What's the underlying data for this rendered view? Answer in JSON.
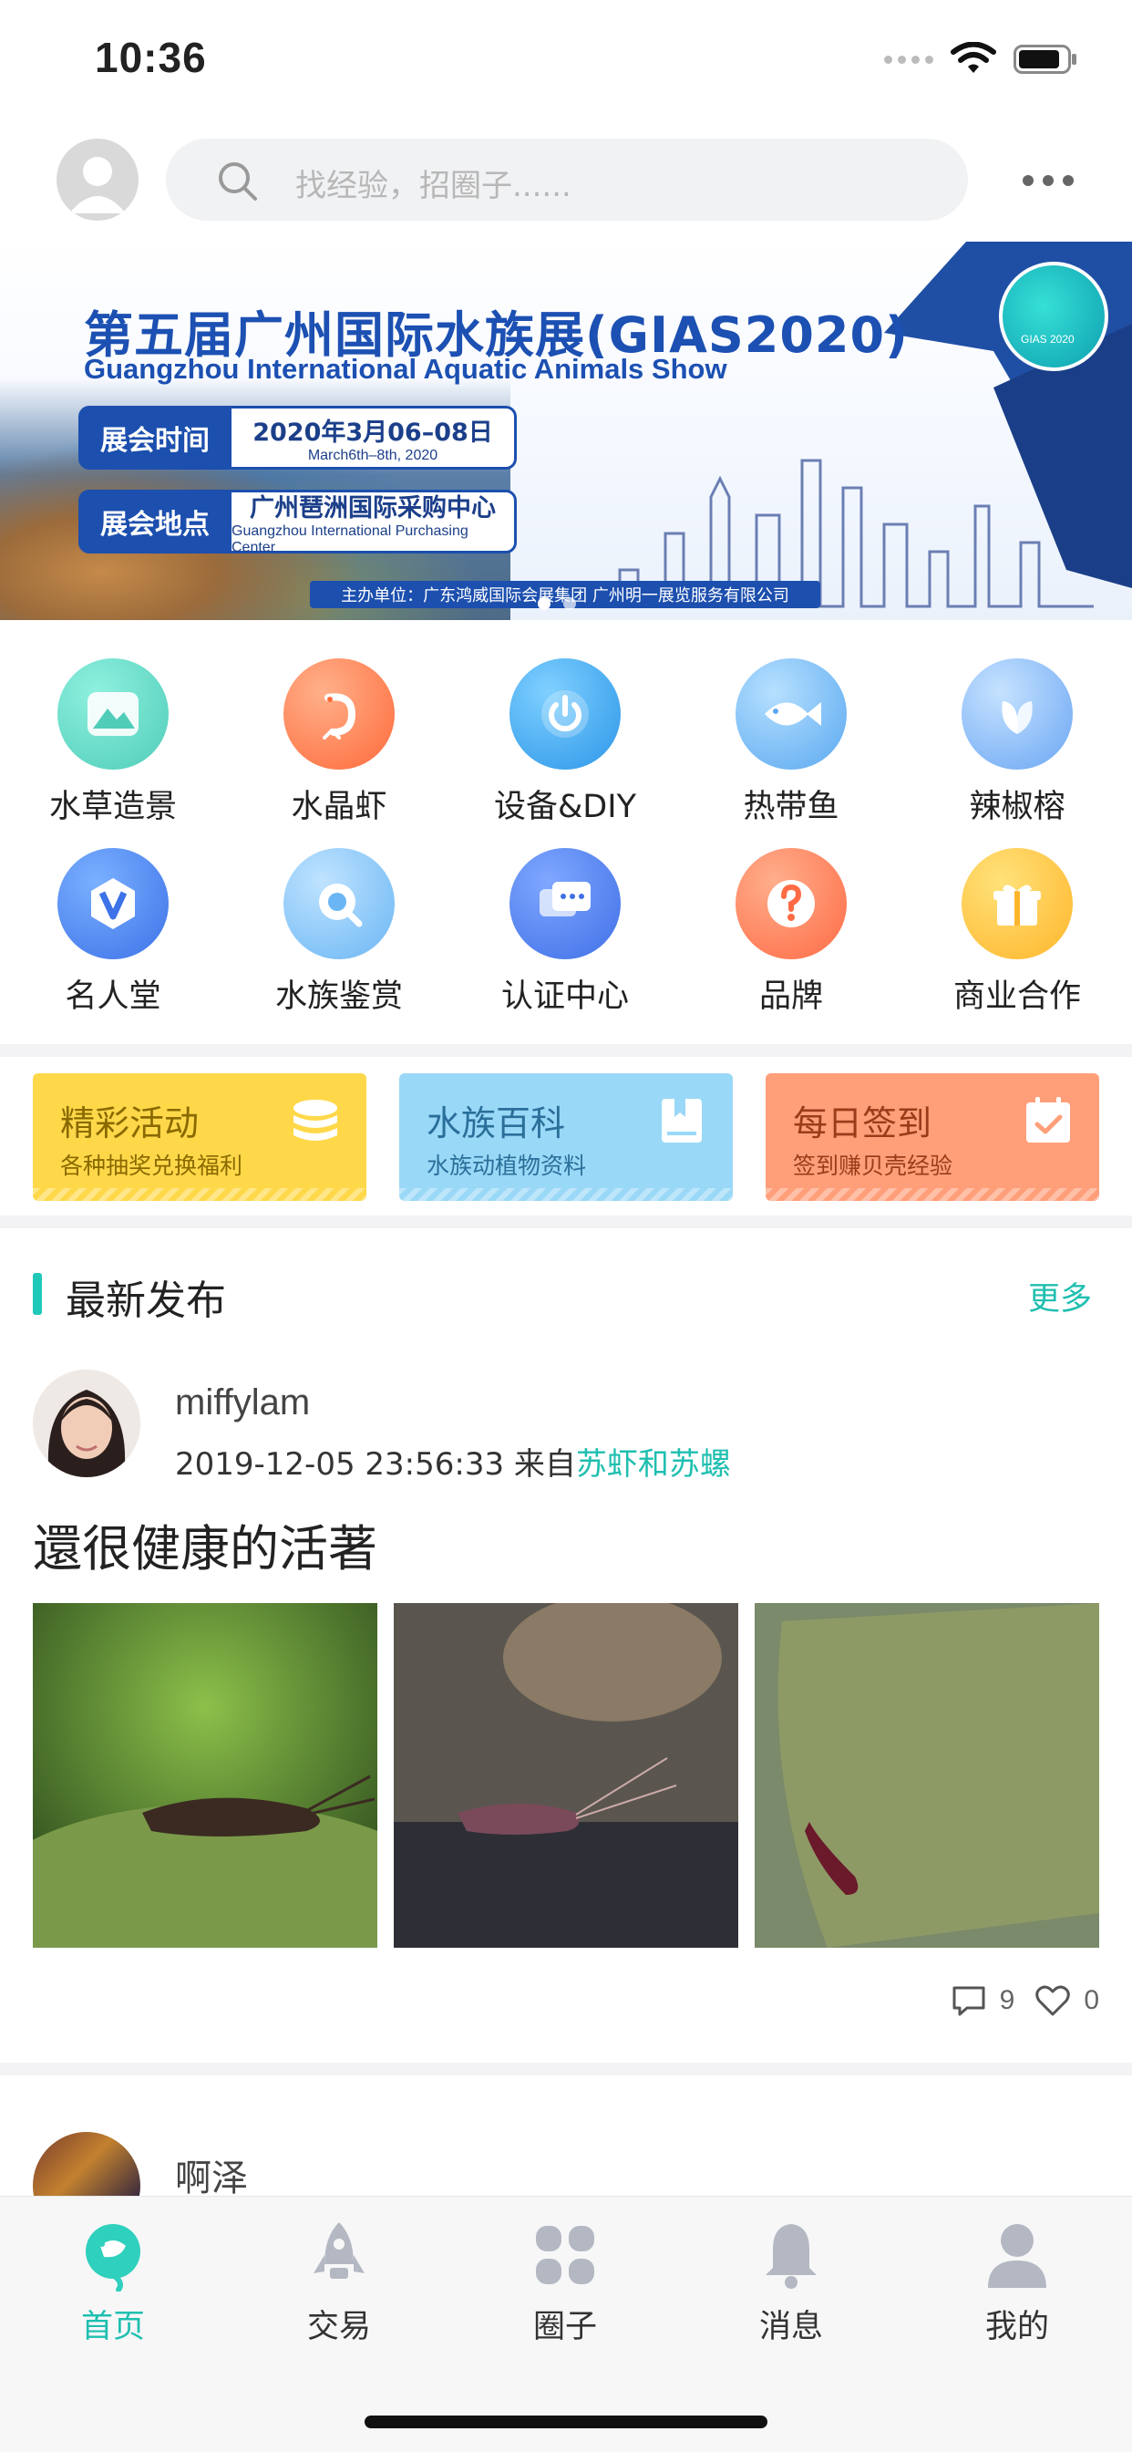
{
  "status_bar": {
    "time": "10:36"
  },
  "header": {
    "search_placeholder": "找经验，招圈子......"
  },
  "banner": {
    "title_cn": "第五届广州国际水族展(GIAS2020)",
    "title_en": "Guangzhou International Aquatic Animals Show",
    "rows": [
      {
        "label": "展会时间",
        "value": "2020年3月06–08日",
        "value_en": "March6th–8th, 2020"
      },
      {
        "label": "展会地点",
        "value": "广州琶洲国际采购中心",
        "value_en": "Guangzhou International Purchasing Center"
      }
    ],
    "organizer": "主办单位：广东鸿威国际会展集团  广州明一展览服务有限公司",
    "logo_text": "GIAS 2020"
  },
  "categories": [
    {
      "label": "水草造景",
      "icon": "landscape-icon",
      "color": "#5ed6c4"
    },
    {
      "label": "水晶虾",
      "icon": "shrimp-icon",
      "color": "#ff7b4a"
    },
    {
      "label": "设备&DIY",
      "icon": "power-icon",
      "color": "#3fa9f0"
    },
    {
      "label": "热带鱼",
      "icon": "fish-icon",
      "color": "#6fb8f5"
    },
    {
      "label": "辣椒榕",
      "icon": "leaf-icon",
      "color": "#7fb6f7"
    },
    {
      "label": "名人堂",
      "icon": "v-badge-icon",
      "color": "#4a84f0"
    },
    {
      "label": "水族鉴赏",
      "icon": "magnifier-icon",
      "color": "#7cc2f7"
    },
    {
      "label": "认证中心",
      "icon": "chat-icon",
      "color": "#4a7ff0"
    },
    {
      "label": "品牌",
      "icon": "question-icon",
      "color": "#ff7a52"
    },
    {
      "label": "商业合作",
      "icon": "gift-icon",
      "color": "#ffc840"
    }
  ],
  "features": [
    {
      "title": "精彩活动",
      "subtitle": "各种抽奖兑换福利",
      "icon": "coins-icon",
      "bg": "#ffd84a",
      "fg": "#8a6a00"
    },
    {
      "title": "水族百科",
      "subtitle": "水族动植物资料",
      "icon": "book-icon",
      "bg": "#9ad8f7",
      "fg": "#2a6f9a"
    },
    {
      "title": "每日签到",
      "subtitle": "签到赚贝壳经验",
      "icon": "calendar-check-icon",
      "bg": "#ff9f7a",
      "fg": "#9a3c1a"
    }
  ],
  "latest": {
    "title": "最新发布",
    "more": "更多",
    "post": {
      "user": "miffylam",
      "time": "2019-12-05 23:56:33",
      "from": "来自",
      "circle": "苏虾和苏螺",
      "title": "還很健康的活著",
      "comments": "9",
      "likes": "0"
    },
    "post2": {
      "user": "啊泽"
    }
  },
  "tabs": [
    {
      "label": "首页",
      "icon": "home-fish-icon",
      "active": true
    },
    {
      "label": "交易",
      "icon": "rocket-icon",
      "active": false
    },
    {
      "label": "圈子",
      "icon": "grid-icon",
      "active": false
    },
    {
      "label": "消息",
      "icon": "bell-icon",
      "active": false
    },
    {
      "label": "我的",
      "icon": "person-icon",
      "active": false
    }
  ],
  "colors": {
    "accent": "#1fbfb0"
  }
}
